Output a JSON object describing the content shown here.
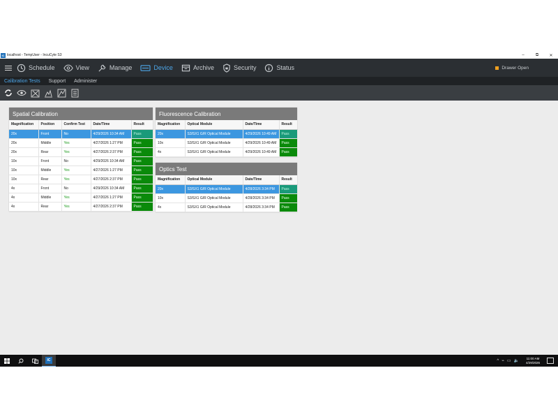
{
  "window": {
    "app_icon_text": "IC",
    "title": "localhost - TempUser - IncuCyte S3",
    "controls": [
      "–",
      "⧉",
      "✕"
    ]
  },
  "nav": {
    "items": [
      {
        "label": "Schedule",
        "icon": "clock-icon"
      },
      {
        "label": "View",
        "icon": "eye-icon"
      },
      {
        "label": "Manage",
        "icon": "wrench-icon"
      },
      {
        "label": "Device",
        "icon": "device-icon"
      },
      {
        "label": "Archive",
        "icon": "archive-icon"
      },
      {
        "label": "Security",
        "icon": "shield-icon"
      },
      {
        "label": "Status",
        "icon": "info-icon"
      }
    ],
    "active": "Device",
    "drawer_status": "Drawer Open"
  },
  "subnav": {
    "items": [
      "Calibration Tests",
      "Support",
      "Administer"
    ],
    "active": "Calibration Tests"
  },
  "toolbar": {
    "icons": [
      "refresh-icon",
      "eye-icon",
      "spatial-calibration-icon",
      "fluorescence-calibration-icon",
      "optics-test-icon",
      "report-icon"
    ]
  },
  "spatial": {
    "title": "Spatial Calibration",
    "columns": [
      "Magnification",
      "Position",
      "Confirm Test",
      "Date/Time",
      "Result"
    ],
    "rows": [
      [
        "20x",
        "Front",
        "No",
        "4/29/2026 10:34 AM",
        "Pass"
      ],
      [
        "20x",
        "Middle",
        "Yes",
        "4/27/2026 1:27 PM",
        "Pass"
      ],
      [
        "20x",
        "Rear",
        "Yes",
        "4/27/2026 2:37 PM",
        "Pass"
      ],
      [
        "10x",
        "Front",
        "No",
        "4/29/2026 10:34 AM",
        "Pass"
      ],
      [
        "10x",
        "Middle",
        "Yes",
        "4/27/2026 1:27 PM",
        "Pass"
      ],
      [
        "10x",
        "Rear",
        "Yes",
        "4/27/2026 2:37 PM",
        "Pass"
      ],
      [
        "4x",
        "Front",
        "No",
        "4/29/2026 10:34 AM",
        "Pass"
      ],
      [
        "4x",
        "Middle",
        "Yes",
        "4/27/2026 1:27 PM",
        "Pass"
      ],
      [
        "4x",
        "Rear",
        "Yes",
        "4/27/2026 2:37 PM",
        "Pass"
      ]
    ]
  },
  "fluorescence": {
    "title": "Fluorescence Calibration",
    "columns": [
      "Magnification",
      "Optical Module",
      "Date/Time",
      "Result"
    ],
    "rows": [
      [
        "20x",
        "S3/SX1 G/R Optical Module",
        "4/29/2026 10:49 AM",
        "Pass"
      ],
      [
        "10x",
        "S3/SX1 G/R Optical Module",
        "4/29/2026 10:49 AM",
        "Pass"
      ],
      [
        "4x",
        "S3/SX1 G/R Optical Module",
        "4/29/2026 10:49 AM",
        "Pass"
      ]
    ]
  },
  "optics": {
    "title": "Optics Test",
    "columns": [
      "Magnification",
      "Optical Module",
      "Date/Time",
      "Result"
    ],
    "rows": [
      [
        "20x",
        "S3/SX1 G/R Optical Module",
        "4/28/2026 3:34 PM",
        "Pass"
      ],
      [
        "10x",
        "S3/SX1 G/R Optical Module",
        "4/28/2026 3:34 PM",
        "Pass"
      ],
      [
        "4x",
        "S3/SX1 G/R Optical Module",
        "4/28/2026 3:34 PM",
        "Pass"
      ]
    ]
  },
  "taskbar": {
    "app_icon_text": "IC",
    "time": "11:00 AM",
    "date": "4/29/2026",
    "tray": [
      "^",
      "⌁",
      "▭",
      "🔈"
    ]
  },
  "colors": {
    "accent": "#4da6e8",
    "pass": "#0a8a0a",
    "selected": "#3c97e0",
    "yes": "#1b9a1b"
  }
}
